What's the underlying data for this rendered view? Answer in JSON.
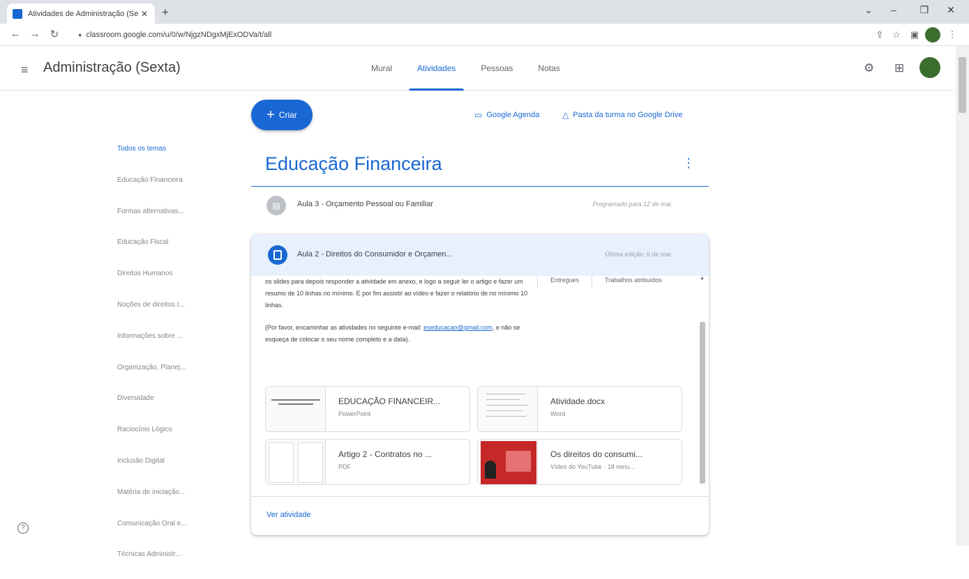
{
  "browser": {
    "tab_title": "Atividades de Administração (Se",
    "tab_close": "✕",
    "new_tab": "+",
    "url": "classroom.google.com/u/0/w/NjgzNDgxMjExODVa/t/all",
    "window_controls": [
      "⌄",
      "–",
      "❐",
      "✕"
    ]
  },
  "header": {
    "class_name": "Administração (Sexta)",
    "tabs": [
      {
        "label": "Mural"
      },
      {
        "label": "Atividades"
      },
      {
        "label": "Pessoas"
      },
      {
        "label": "Notas"
      }
    ],
    "active_tab": "Atividades"
  },
  "actions": {
    "create_label": "Criar",
    "calendar_link": "Google Agenda",
    "drive_link": "Pasta da turma no Google Drive"
  },
  "topics": [
    "Todos os temas",
    "Educação Financeira",
    "Formas alternativas...",
    "Educação Fiscal",
    "Direitos Humanos",
    "Noções de direitos t...",
    "Informações sobre ...",
    "Organização, Planej...",
    "Diversidade",
    "Raciocínio Lógico",
    "Inclusão Digital",
    "Matéria de iniciação...",
    "Comunicação Oral e...",
    "Técnicas Administr..."
  ],
  "topic": {
    "title": "Educação Financeira",
    "items": [
      {
        "name": "Aula 3 - Orçamento Pessoal ou Familiar",
        "meta": "Programado para 12 de mai."
      },
      {
        "name": "Aula 2 - Direitos do Consumidor e Orçamen...",
        "meta": "Última edição: 6 de mai."
      }
    ]
  },
  "expanded": {
    "description_1": "os slides para depois responder a atividade em anexo, e logo a seguir ler o artigo e fazer um resumo de 10 linhas no mínimo. E por fim assistir ao vídeo e fazer o relatório de no mínimo 10 linhas.",
    "description_2_prefix": "(Por favor, encaminhar as atividades no seguinte e-mail:",
    "email": "eseducacao@gmail.com",
    "description_2_suffix": ", e não se esqueça de colocar o seu nome completo e a data).",
    "stats": [
      "Entregues",
      "Trabalhos atribuídos"
    ],
    "attachments": [
      {
        "title": "EDUCAÇÃO FINANCEIR...",
        "type": "PowerPoint"
      },
      {
        "title": "Atividade.docx",
        "type": "Word"
      },
      {
        "title": "Artigo 2 - Contratos no ...",
        "type": "PDF"
      },
      {
        "title": "Os direitos do consumi...",
        "type": "Vídeo do YouTube · 18 minu..."
      }
    ],
    "view_link": "Ver atividade"
  },
  "help_glyph": "?"
}
